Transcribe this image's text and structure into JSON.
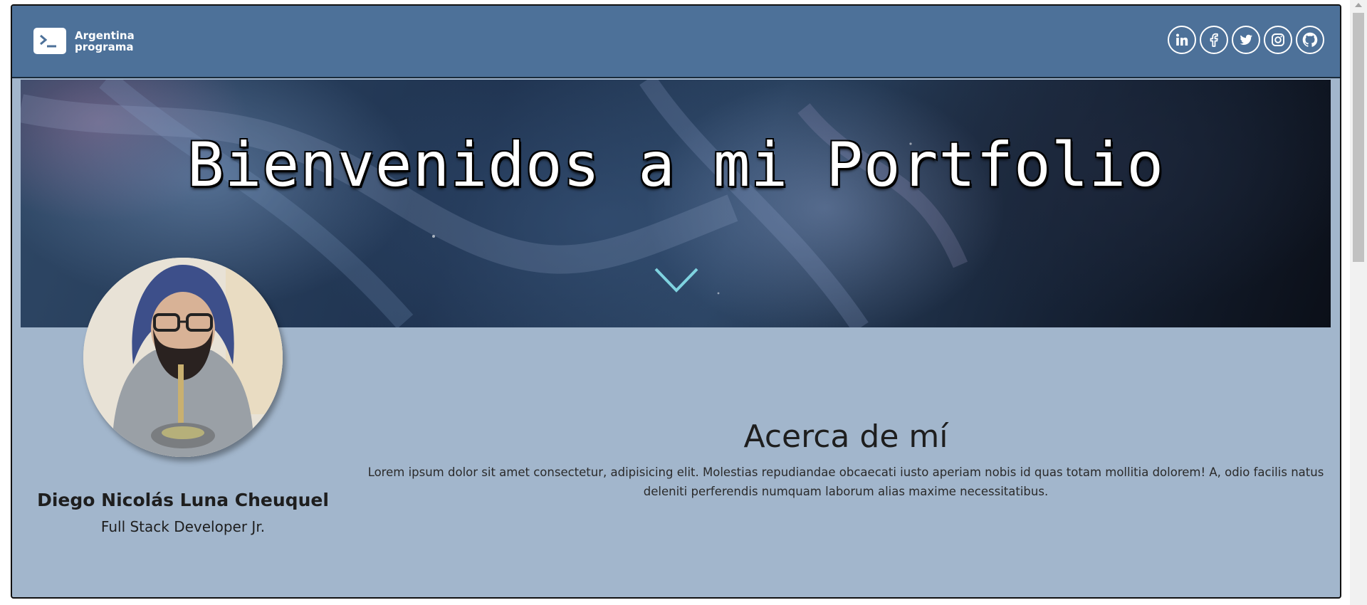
{
  "header": {
    "logo_line1": "Argentina",
    "logo_line2": "programa",
    "social_icons": [
      "linkedin-icon",
      "facebook-icon",
      "twitter-icon",
      "instagram-icon",
      "github-icon"
    ]
  },
  "banner": {
    "title": "Bienvenidos a mi Portfolio",
    "chevron": "chevron-down-icon"
  },
  "profile": {
    "name": "Diego Nicolás Luna Cheuquel",
    "role": "Full Stack Developer Jr."
  },
  "about": {
    "title": "Acerca de mí",
    "text": "Lorem ipsum dolor sit amet consectetur, adipisicing elit. Molestias repudiandae obcaecati iusto aperiam nobis id quas totam mollitia dolorem! A, odio facilis natus deleniti perferendis numquam laborum alias maxime necessitatibus."
  },
  "colors": {
    "header_bg": "#4d7199",
    "page_bg": "#a2b6cc",
    "chevron": "#7fd3e0"
  }
}
